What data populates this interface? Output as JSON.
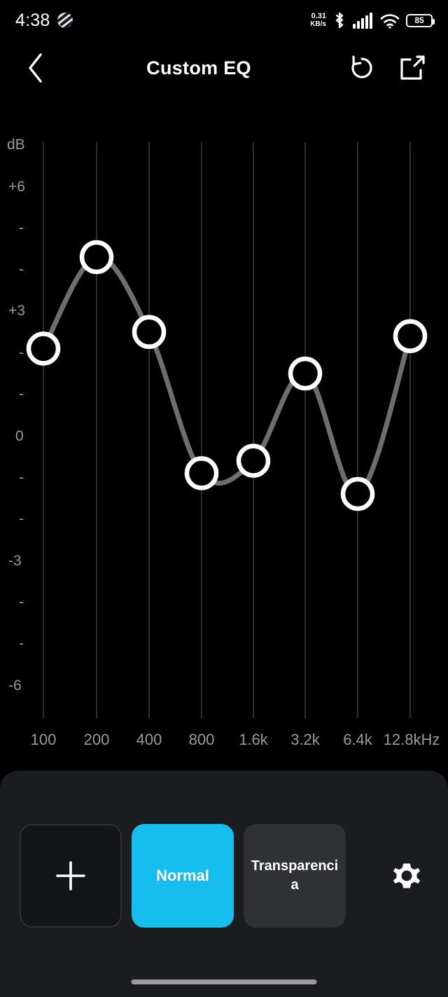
{
  "status_bar": {
    "time": "4:38",
    "app_logo_icon": "zebra-app-icon",
    "net_speed_value": "0.31",
    "net_speed_unit": "KB/s",
    "bluetooth_icon": "bluetooth-icon",
    "signal_icon": "cellular-signal-icon",
    "wifi_icon": "wifi-icon",
    "battery_level": "85",
    "battery_icon": "battery-icon"
  },
  "nav": {
    "back_icon": "chevron-left-icon",
    "title": "Custom EQ",
    "reset_icon": "reset-rotate-icon",
    "share_icon": "share-export-icon"
  },
  "chart_data": {
    "type": "line",
    "title": "Custom EQ",
    "xlabel": "",
    "ylabel": "dB",
    "y_axis_unit_label": "dB",
    "categories": [
      "100",
      "200",
      "400",
      "800",
      "1.6k",
      "3.2k",
      "6.4k",
      "12.8kHz"
    ],
    "x_tick_labels": [
      "100",
      "200",
      "400",
      "800",
      "1.6k",
      "3.2k",
      "6.4k",
      "12.8kHz"
    ],
    "y_tick_labels": [
      "+6",
      "-",
      "-",
      "+3",
      "-",
      "-",
      "0",
      "-",
      "-",
      "-3",
      "-",
      "-",
      "-6"
    ],
    "y_major_labels": [
      "+6",
      "+3",
      "0",
      "-3",
      "-6"
    ],
    "ylim": [
      -6,
      6
    ],
    "values": [
      2.1,
      4.3,
      2.5,
      -0.9,
      -0.6,
      1.5,
      -1.4,
      2.4
    ],
    "series": [
      {
        "name": "Custom EQ",
        "values": [
          2.1,
          4.3,
          2.5,
          -0.9,
          -0.6,
          1.5,
          -1.4,
          2.4
        ]
      }
    ],
    "grid": true,
    "legend": "none",
    "line_color": "#6e6e6e",
    "node_color": "#ffffff",
    "grid_color": "#3a3a3a"
  },
  "bottom": {
    "add_preset_label": "+",
    "add_preset_icon": "plus-icon",
    "presets": [
      {
        "label": "Normal",
        "selected": true
      },
      {
        "label": "Transparencia",
        "selected": false
      }
    ],
    "settings_icon": "gear-icon",
    "accent_color": "#16bef0",
    "inactive_color": "#303135"
  },
  "system": {
    "home_indicator": "home-indicator"
  }
}
